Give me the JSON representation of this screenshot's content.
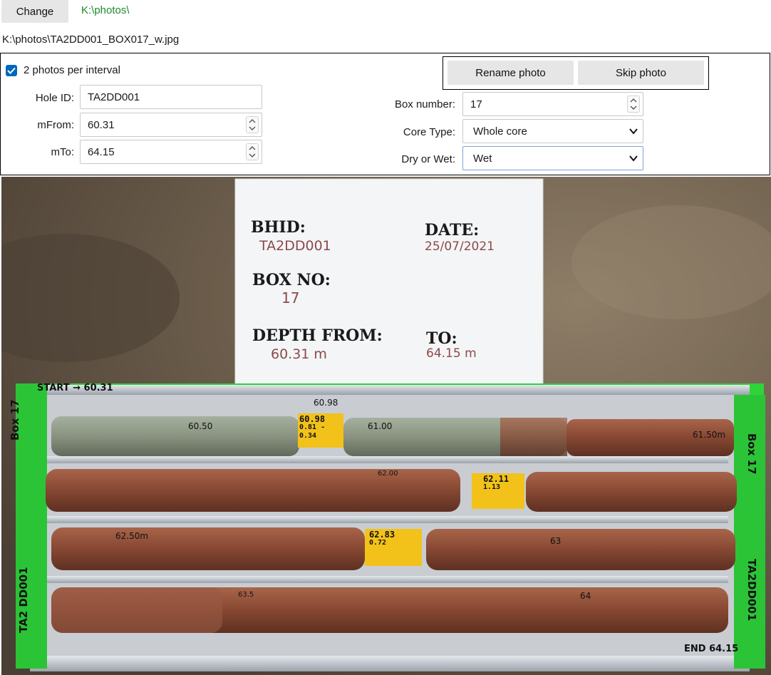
{
  "toolbar": {
    "change_label": "Change",
    "folder": "K:\\photos\\"
  },
  "current_file": "K:\\photos\\TA2DD001_BOX017_w.jpg",
  "form": {
    "per_interval_label": "2 photos per interval",
    "per_interval_checked": true,
    "hole_id_label": "Hole ID:",
    "hole_id_value": "TA2DD001",
    "mfrom_label": "mFrom:",
    "mfrom_value": "60.31",
    "mto_label": "mTo:",
    "mto_value": "64.15",
    "box_number_label": "Box number:",
    "box_number_value": "17",
    "core_type_label": "Core Type:",
    "core_type_value": "Whole core",
    "dry_wet_label": "Dry or Wet:",
    "dry_wet_value": "Wet"
  },
  "actions": {
    "rename_label": "Rename photo",
    "skip_label": "Skip photo"
  },
  "photo": {
    "board": {
      "bhid_label": "BHID:",
      "bhid_value": "TA2DD001",
      "date_label": "DATE:",
      "date_value": "25/07/2021",
      "box_label": "BOX NO:",
      "box_value": "17",
      "depth_label": "DEPTH FROM:",
      "depth_value": "60.31 m",
      "to_label": "TO:",
      "to_value": "64.15 m"
    },
    "tray": {
      "start_text": "START → 60.31",
      "end_text": "END 64.15",
      "left_side_top": "Box 17",
      "left_side_bottom": "TA2 DD001",
      "right_side_top": "Box 17",
      "right_side_bottom": "TA2DD001",
      "top_rail_mark": "60.98",
      "blocks": [
        {
          "line1": "60.98",
          "line2": "0.81 - 0.34"
        },
        {
          "line1": "62.11",
          "line2": "1.13"
        },
        {
          "line1": "62.83",
          "line2": "0.72"
        }
      ],
      "core_marks": [
        "60.50",
        "61.00",
        "61.50m",
        "62.00",
        "62.50m",
        "63",
        "63.5",
        "64"
      ]
    }
  },
  "colors": {
    "accent": "#0067c0",
    "folder_text": "#1f8a2a",
    "tray_green": "#2fd43a",
    "core_brown": "#8a4a34",
    "core_grey": "#8a9484",
    "block_yellow": "#f2c21a"
  }
}
